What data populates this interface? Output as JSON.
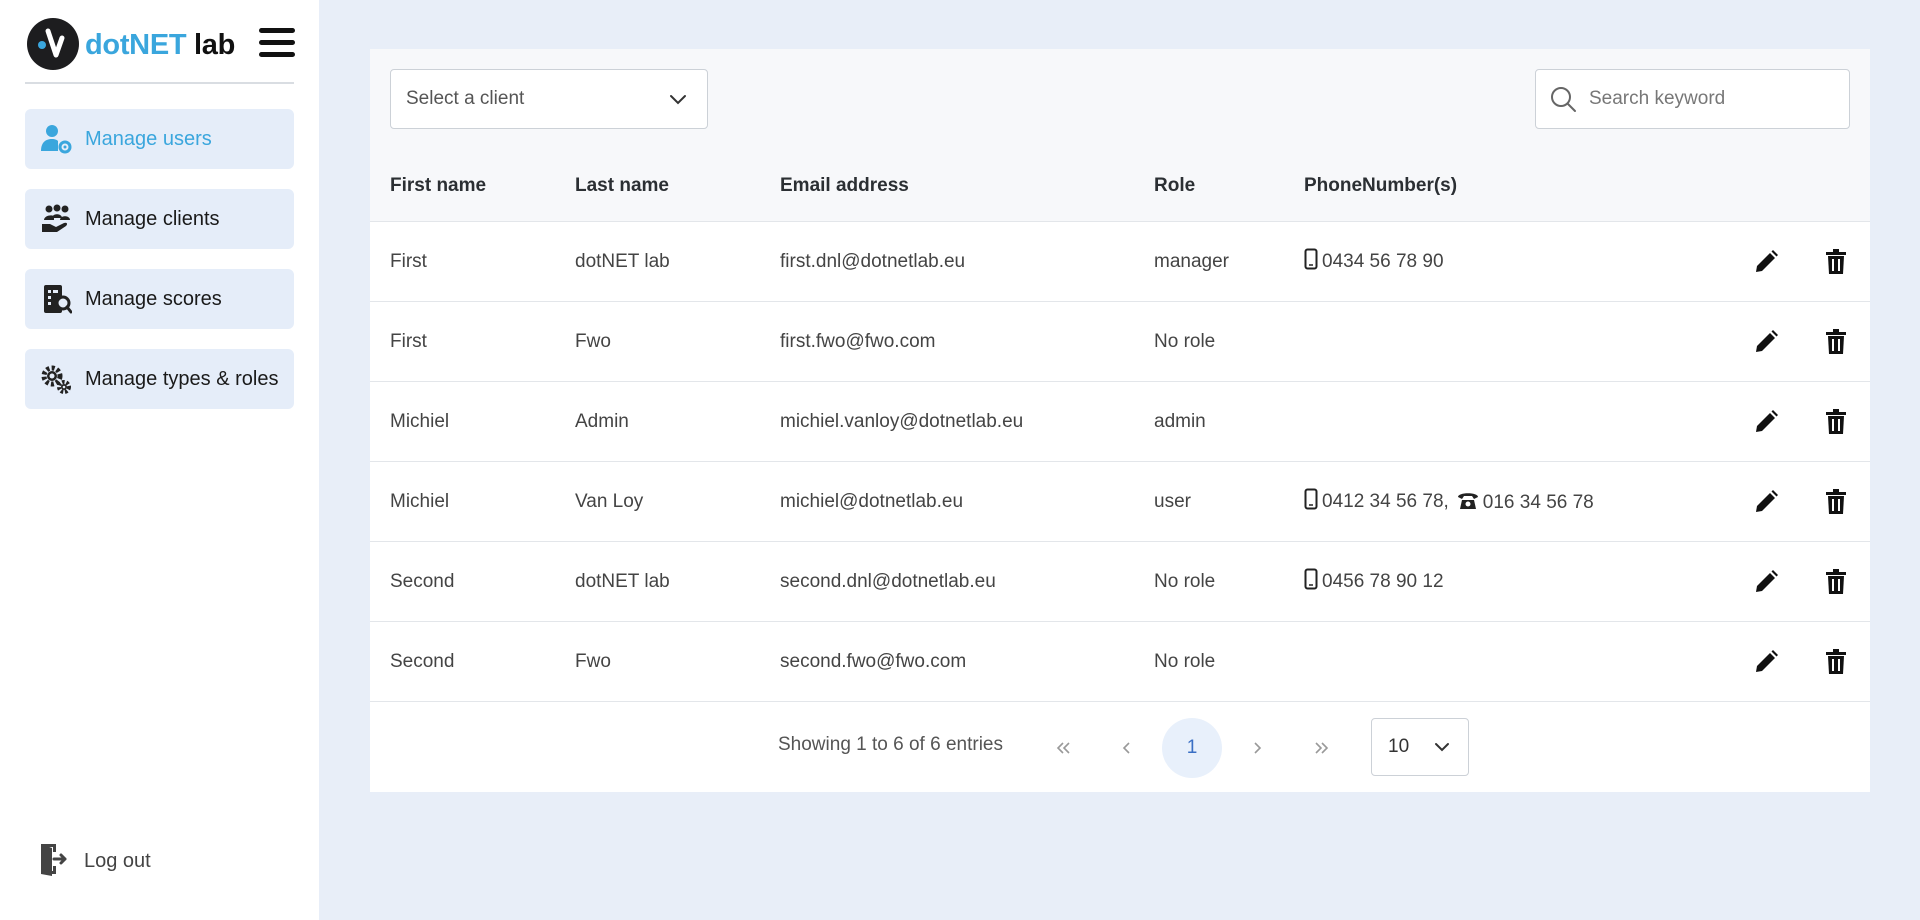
{
  "brand": {
    "name_part1": "dotNET",
    "name_part2": " lab"
  },
  "sidebar": {
    "items": [
      {
        "label": "Manage users",
        "icon": "user-cog-icon",
        "active": true
      },
      {
        "label": "Manage clients",
        "icon": "clients-icon",
        "active": false
      },
      {
        "label": "Manage scores",
        "icon": "scores-icon",
        "active": false
      },
      {
        "label": "Manage types & roles",
        "icon": "gears-icon",
        "active": false
      }
    ],
    "logout_label": "Log out"
  },
  "toolbar": {
    "client_select_placeholder": "Select a client",
    "search_placeholder": "Search keyword"
  },
  "table": {
    "headers": [
      "First name",
      "Last name",
      "Email address",
      "Role",
      "PhoneNumber(s)"
    ],
    "rows": [
      {
        "first": "First",
        "last": "dotNET lab",
        "email": "first.dnl@dotnetlab.eu",
        "role": "manager",
        "mobile": "0434 56 78 90",
        "landline": ""
      },
      {
        "first": "First",
        "last": "Fwo",
        "email": "first.fwo@fwo.com",
        "role": "No role",
        "mobile": "",
        "landline": ""
      },
      {
        "first": "Michiel",
        "last": "Admin",
        "email": "michiel.vanloy@dotnetlab.eu",
        "role": "admin",
        "mobile": "",
        "landline": ""
      },
      {
        "first": "Michiel",
        "last": "Van Loy",
        "email": "michiel@dotnetlab.eu",
        "role": "user",
        "mobile": "0412 34 56 78,",
        "landline": "016 34 56 78"
      },
      {
        "first": "Second",
        "last": "dotNET lab",
        "email": "second.dnl@dotnetlab.eu",
        "role": "No role",
        "mobile": "0456 78 90 12",
        "landline": ""
      },
      {
        "first": "Second",
        "last": "Fwo",
        "email": "second.fwo@fwo.com",
        "role": "No role",
        "mobile": "",
        "landline": ""
      }
    ]
  },
  "pagination": {
    "info": "Showing 1 to 6 of 6 entries",
    "current_page": "1",
    "page_size": "10"
  },
  "colors": {
    "accent": "#3aa6dd",
    "sidebar_item_bg": "#e5edf9",
    "page_bg": "#e8eef8"
  }
}
